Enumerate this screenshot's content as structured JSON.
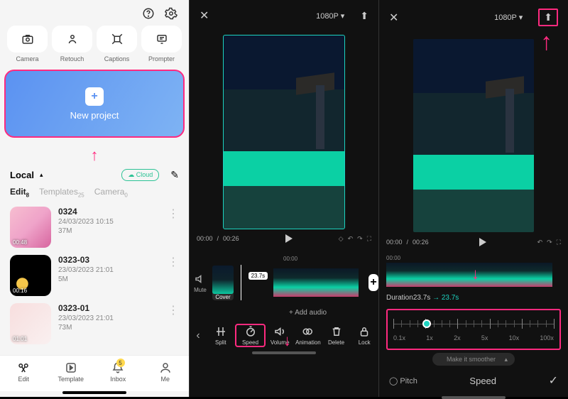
{
  "left": {
    "tools": [
      "Camera",
      "Retouch",
      "Captions",
      "Prompter"
    ],
    "new_project": "New project",
    "local_label": "Local",
    "cloud_chip": "☁ Cloud",
    "tabs": {
      "edit": "Edit",
      "edit_n": "8",
      "templates": "Templates",
      "templates_n": "25",
      "camera": "Camera",
      "camera_n": "0"
    },
    "projects": [
      {
        "name": "0324",
        "date": "24/03/2023 10:15",
        "size": "37M",
        "dur": "00:48"
      },
      {
        "name": "0323-03",
        "date": "23/03/2023 21:01",
        "size": "5M",
        "dur": "00:16"
      },
      {
        "name": "0323-01",
        "date": "23/03/2023 21:01",
        "size": "73M",
        "dur": "01:01"
      }
    ],
    "nav": {
      "edit": "Edit",
      "template": "Template",
      "inbox": "Inbox",
      "me": "Me",
      "badge": "5"
    }
  },
  "mid": {
    "resolution": "1080P",
    "time_current": "00:00",
    "time_total": "00:26",
    "timeline_scale": "00:00",
    "clip_badge": "23.7s",
    "cover_label": "Cover",
    "mute_label": "Mute",
    "add_audio": "+ Add audio",
    "tools": [
      "Split",
      "Speed",
      "Volume",
      "Animation",
      "Delete",
      "Lock"
    ]
  },
  "right": {
    "resolution": "1080P",
    "time_current": "00:00",
    "time_total": "00:26",
    "timeline_scale": "00:00",
    "duration_prefix": "Duration",
    "duration_val": "23.7s",
    "duration_arrow": "23.7s",
    "speed_marks": [
      "0.1x",
      "1x",
      "2x",
      "5x",
      "10x",
      "100x"
    ],
    "smoother": "Make it smoother",
    "pitch": "Pitch",
    "speed_title": "Speed"
  }
}
